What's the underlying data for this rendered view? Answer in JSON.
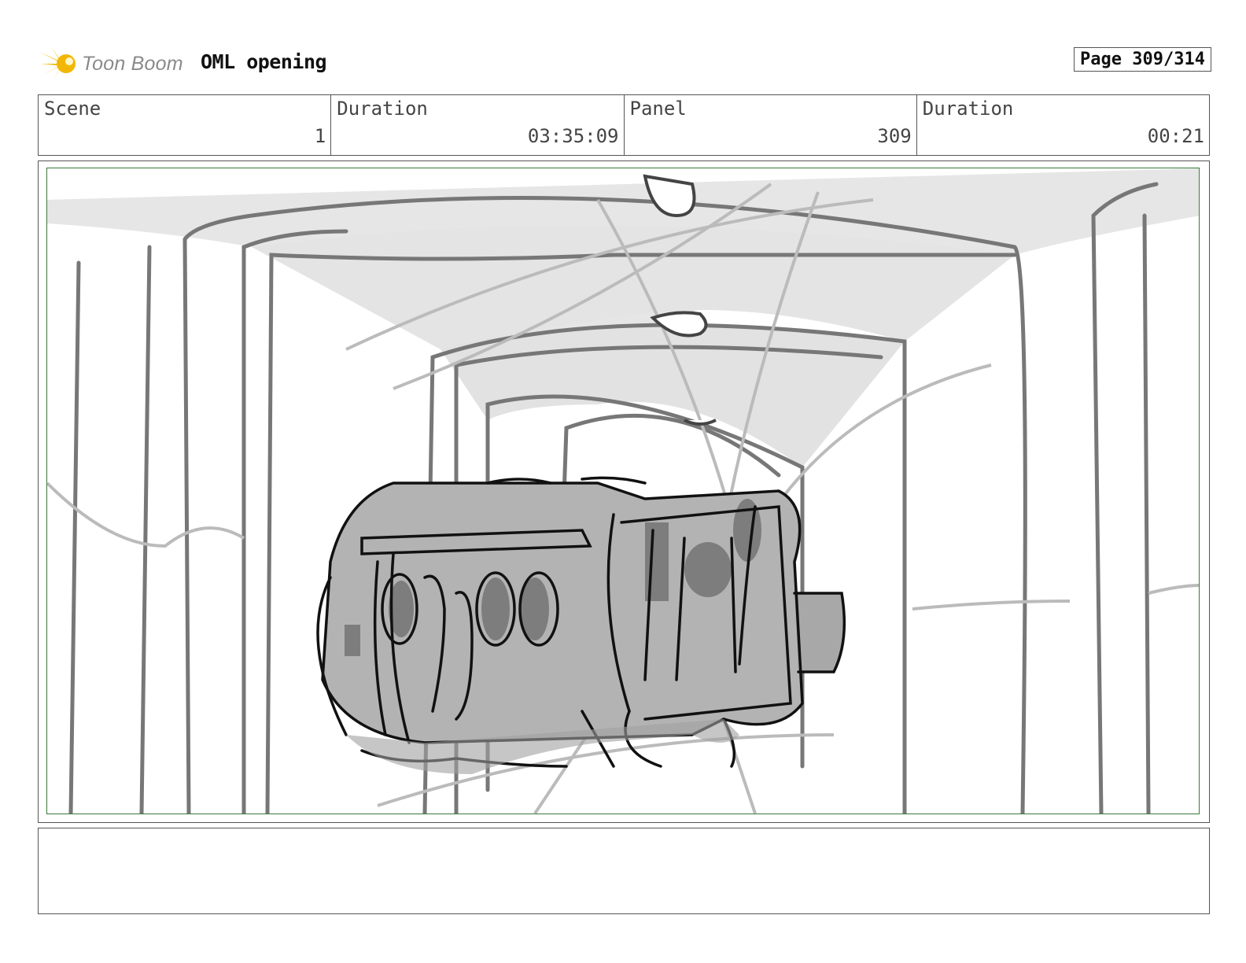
{
  "header": {
    "logo_text": "Toon Boom",
    "project_title": "OML opening",
    "page_label": "Page 309/314"
  },
  "info": {
    "scene_label": "Scene",
    "scene_value": "1",
    "scene_duration_label": "Duration",
    "scene_duration_value": "03:35:09",
    "panel_label": "Panel",
    "panel_value": "309",
    "panel_duration_label": "Duration",
    "panel_duration_value": "00:21"
  },
  "panel": {
    "image_icon": "storyboard-sketch-train-in-tunnel"
  },
  "notes": {
    "text": ""
  },
  "colors": {
    "logo_star": "#f2b705",
    "frame_green": "#3a7a3a",
    "sketch_dark": "#111111",
    "sketch_mid": "#777777",
    "sketch_fill": "#b3b3b3",
    "ceiling_fill": "#e6e6e6"
  }
}
